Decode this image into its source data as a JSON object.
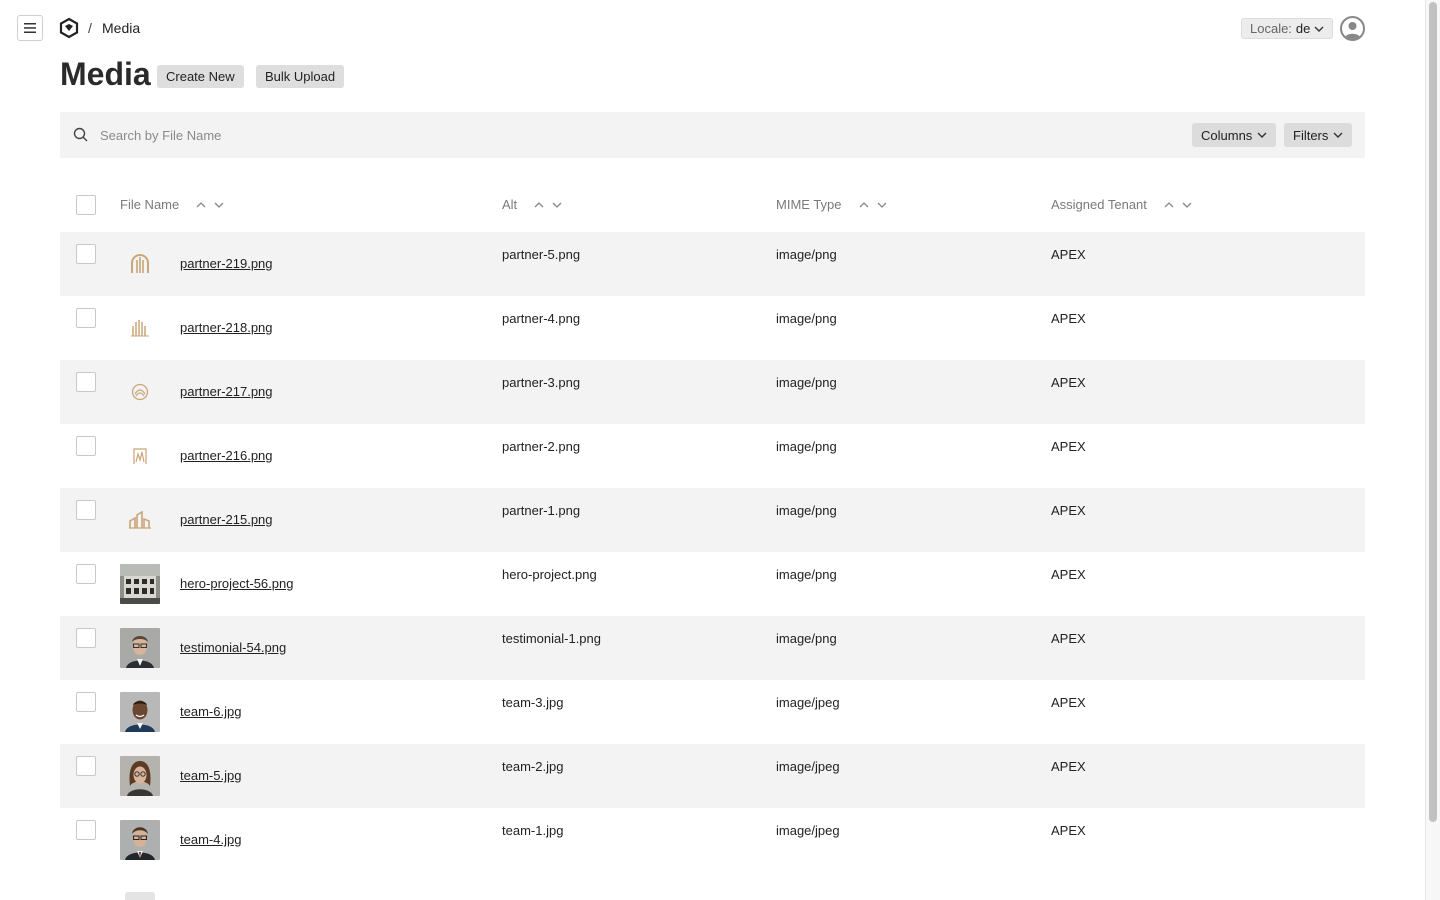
{
  "header": {
    "breadcrumb_sep": "/",
    "breadcrumb_current": "Media",
    "locale_label": "Locale:",
    "locale_value": "de"
  },
  "page": {
    "title": "Media",
    "create_new": "Create New",
    "bulk_upload": "Bulk Upload"
  },
  "search": {
    "placeholder": "Search by File Name",
    "columns_label": "Columns",
    "filters_label": "Filters"
  },
  "table": {
    "headers": {
      "file_name": "File Name",
      "alt": "Alt",
      "mime_type": "MIME Type",
      "tenant": "Assigned Tenant"
    },
    "rows": [
      {
        "file": "partner-219.png",
        "alt": "partner-5.png",
        "mime": "image/png",
        "tenant": "APEX"
      },
      {
        "file": "partner-218.png",
        "alt": "partner-4.png",
        "mime": "image/png",
        "tenant": "APEX"
      },
      {
        "file": "partner-217.png",
        "alt": "partner-3.png",
        "mime": "image/png",
        "tenant": "APEX"
      },
      {
        "file": "partner-216.png",
        "alt": "partner-2.png",
        "mime": "image/png",
        "tenant": "APEX"
      },
      {
        "file": "partner-215.png",
        "alt": "partner-1.png",
        "mime": "image/png",
        "tenant": "APEX"
      },
      {
        "file": "hero-project-56.png",
        "alt": "hero-project.png",
        "mime": "image/png",
        "tenant": "APEX"
      },
      {
        "file": "testimonial-54.png",
        "alt": "testimonial-1.png",
        "mime": "image/png",
        "tenant": "APEX"
      },
      {
        "file": "team-6.jpg",
        "alt": "team-3.jpg",
        "mime": "image/jpeg",
        "tenant": "APEX"
      },
      {
        "file": "team-5.jpg",
        "alt": "team-2.jpg",
        "mime": "image/jpeg",
        "tenant": "APEX"
      },
      {
        "file": "team-4.jpg",
        "alt": "team-1.jpg",
        "mime": "image/jpeg",
        "tenant": "APEX"
      }
    ]
  },
  "colors": {
    "partner_logo": "#c9a57a",
    "row_alt": "#f3f3f3"
  }
}
